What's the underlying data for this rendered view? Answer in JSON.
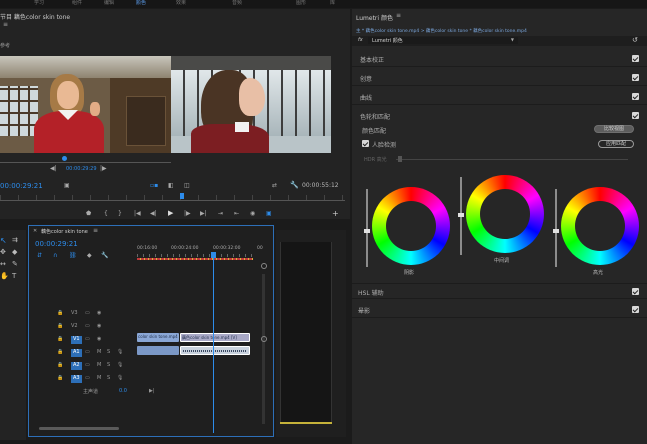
{
  "top_menu": {
    "items": [
      "学习",
      "组件",
      "编辑",
      "颜色",
      "效果",
      "音频",
      "图形",
      "库"
    ]
  },
  "program_monitor": {
    "tab": "节目 藕色color skin tone",
    "sublabel": "参考",
    "timecode_left": "00:00:29:21",
    "timecode_center": "00:00:29:29",
    "duration": "00:00:55:12"
  },
  "lumetri_scopes": {
    "title": "Lumetri 颜色"
  },
  "lumetri": {
    "breadcrumb": "主 * 藕色color skin tone.mp4 > 藕色color skin tone * 藕色color skin tone.mp4",
    "fx_label": "fx",
    "effect_name": "Lumetri 颜色",
    "sections": [
      "基本校正",
      "创意",
      "曲线",
      "色轮和匹配"
    ],
    "color_match_label": "颜色匹配",
    "compare_view_button": "比较视图",
    "face_detect_label": "人脸检测",
    "apply_match_button": "应用匹配",
    "hdr_label": "HDR 高光",
    "wheels": [
      "阴影",
      "中间调",
      "高光"
    ],
    "bottom_sections": [
      "HSL 辅助",
      "晕影"
    ]
  },
  "timeline": {
    "tab": "藕色color skin tone",
    "timecode": "00:00:29:21",
    "ruler": [
      "00:16:00",
      "00:00:24:00",
      "00:00:32:00",
      "00"
    ],
    "video_tracks": [
      "V3",
      "V2",
      "V1"
    ],
    "audio_tracks": [
      "A1",
      "A2",
      "A3"
    ],
    "master_label": "主声道",
    "master_value": "0.0",
    "clips": {
      "v1_a": "color skin tone.mp4 [V]",
      "v1_b": "藕色color skin tone.mp4 [V]"
    }
  },
  "colors": {
    "accent": "#2d8ceb",
    "panel": "#232323",
    "clip_video": "#8aa7d6",
    "clip_audio": "#7b98c6"
  }
}
